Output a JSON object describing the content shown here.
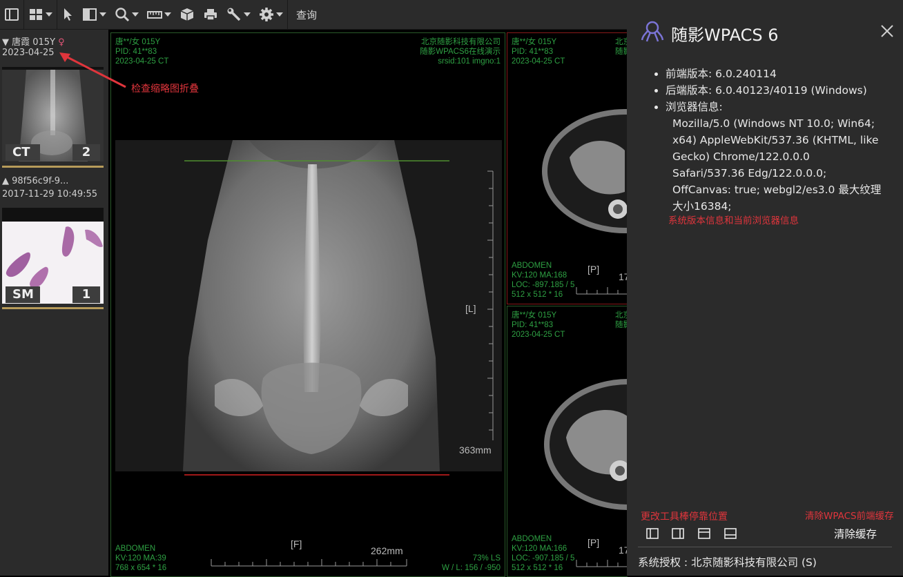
{
  "toolbar": {
    "query_label": "查询",
    "icons": [
      "sidebar-toggle-icon",
      "layout-grid-icon",
      "cursor-icon",
      "window-level-icon",
      "zoom-icon",
      "ruler-icon",
      "cube-icon",
      "print-icon",
      "wrench-icon",
      "gear-icon"
    ]
  },
  "sidebar": {
    "studies": [
      {
        "header": "▼ 唐霞 015Y",
        "gender_symbol": "♀",
        "date": "2023-04-25",
        "modality": "CT",
        "count": "2"
      },
      {
        "header": "▲ 98f56c9f-9...",
        "date": "2017-11-29 10:49:55",
        "modality": "SM",
        "count": "1"
      }
    ]
  },
  "viewport_main": {
    "top_left": [
      "唐**/女 015Y",
      "PID: 41**83",
      "2023-04-25 CT"
    ],
    "top_right": [
      "北京随影科技有限公司",
      "随影WPACS6在线演示",
      "srsid:101 imgno:1"
    ],
    "bottom_left": [
      "ABDOMEN",
      "KV:120 MA:39",
      "768 x 654 * 16"
    ],
    "bottom_right": [
      "73% LS",
      "W / L:   156 / -950"
    ],
    "label_left": "[L]",
    "label_bottom": "[F]",
    "scale_vertical": "363mm",
    "scale_horizontal": "262mm"
  },
  "viewport_top": {
    "top_left": [
      "唐**/女 015Y",
      "PID: 41**83",
      "2023-04-25 CT"
    ],
    "top_right_partial": [
      "北京",
      "随影"
    ],
    "bottom_left": [
      "ABDOMEN",
      "KV:120 MA:168",
      "LOC: -897.185 / 5",
      "512 x 512 * 16"
    ],
    "label_p": "[P]",
    "scale_partial": "17"
  },
  "viewport_bottom": {
    "top_left": [
      "唐**/女 015Y",
      "PID: 41**83",
      "2023-04-25 CT"
    ],
    "top_right_partial": [
      "北京",
      "随影"
    ],
    "bottom_left": [
      "ABDOMEN",
      "KV:120 MA:166",
      "LOC: -907.185 / 5",
      "512 x 512 * 16"
    ],
    "label_p": "[P]",
    "scale_partial": "17"
  },
  "annotations": {
    "thumbnail_collapse": "检查缩略图折叠",
    "version_info": "系统版本信息和当前浏览器信息",
    "dock_position": "更改工具棒停靠位置",
    "clear_cache": "清除WPACS前端缓存"
  },
  "about": {
    "title": "随影WPACS 6",
    "items": [
      {
        "label": "前端版本: 6.0.240114"
      },
      {
        "label": "后端版本: 6.0.40123/40119 (Windows)"
      },
      {
        "label": "浏览器信息:"
      }
    ],
    "user_agent": "Mozilla/5.0 (Windows NT 10.0; Win64; x64) AppleWebKit/537.36 (KHTML, like Gecko) Chrome/122.0.0.0 Safari/537.36 Edg/122.0.0.0; OffCanvas: true; webgl2/es3.0 最大纹理大小16384;",
    "clear_button": "清除缓存",
    "license": "系统授权 : 北京随影科技有限公司 (S)"
  },
  "colors": {
    "overlay_green": "#2ea043",
    "annotation_red": "#e0353c",
    "thumb_bar": "#b79b5a",
    "panel": "#2b2b2b"
  }
}
